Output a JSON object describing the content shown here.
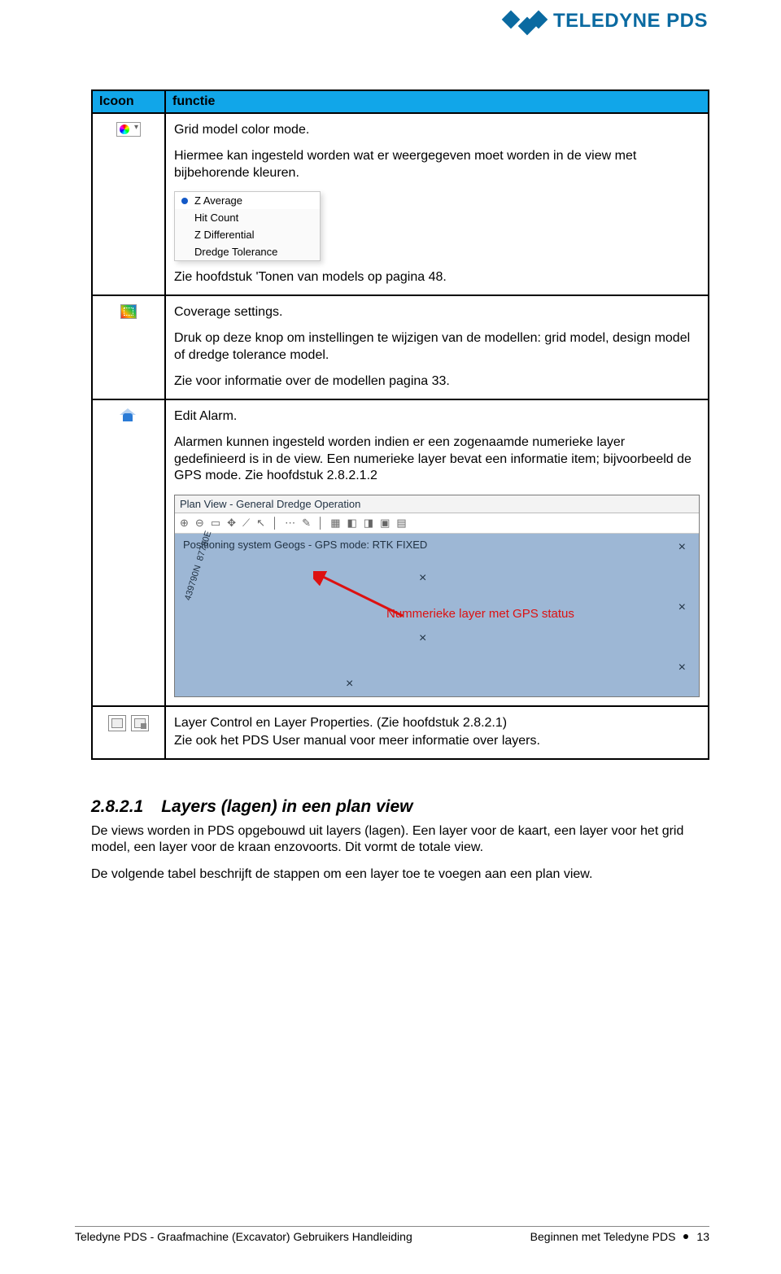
{
  "brand": {
    "name": "TELEDYNE PDS"
  },
  "table": {
    "headers": {
      "icon": "Icoon",
      "func": "functie"
    },
    "rows": {
      "r1": {
        "title": "Grid model color mode.",
        "desc": "Hiermee kan ingesteld worden wat er weergegeven moet worden in de view met bijbehorende kleuren.",
        "menu": {
          "items": [
            "Z Average",
            "Hit Count",
            "Z Differential",
            "Dredge Tolerance"
          ],
          "selected": "Z Average"
        },
        "ref": "Zie hoofdstuk 'Tonen van models op pagina 48."
      },
      "r2": {
        "title": "Coverage settings.",
        "desc": "Druk op deze knop om instellingen te wijzigen van de modellen: grid model, design model of dredge tolerance model.",
        "ref": "Zie voor informatie over de modellen pagina 33."
      },
      "r3": {
        "title": "Edit Alarm.",
        "desc": "Alarmen kunnen ingesteld worden indien er een zogenaamde numerieke layer gedefinieerd is in de view. Een numerieke layer bevat een informatie item; bijvoorbeeld de GPS mode. Zie hoofdstuk 2.8.2.1.2",
        "plan": {
          "title": "Plan View - General Dredge Operation",
          "status": "Positioning system Geogs - GPS mode: RTK FIXED",
          "annotation": "Nummerieke layer met GPS status",
          "coord1": "439790N",
          "coord2": "87780E"
        }
      },
      "r4": {
        "text1": "Layer Control en Layer Properties. (Zie hoofdstuk 2.8.2.1)",
        "text2": "Zie ook het PDS User manual voor meer informatie over layers."
      }
    }
  },
  "section": {
    "num": "2.8.2.1",
    "title": "Layers (lagen) in een plan view",
    "p1": "De views worden in PDS opgebouwd uit layers (lagen). Een layer voor de kaart, een layer voor het grid model, een layer voor de kraan enzovoorts. Dit vormt de totale view.",
    "p2": "De volgende tabel beschrijft de stappen om een layer toe te voegen aan een plan view."
  },
  "footer": {
    "left": "Teledyne PDS - Graafmachine (Excavator) Gebruikers Handleiding",
    "right_title": "Beginnen met Teledyne PDS",
    "page": "13"
  }
}
